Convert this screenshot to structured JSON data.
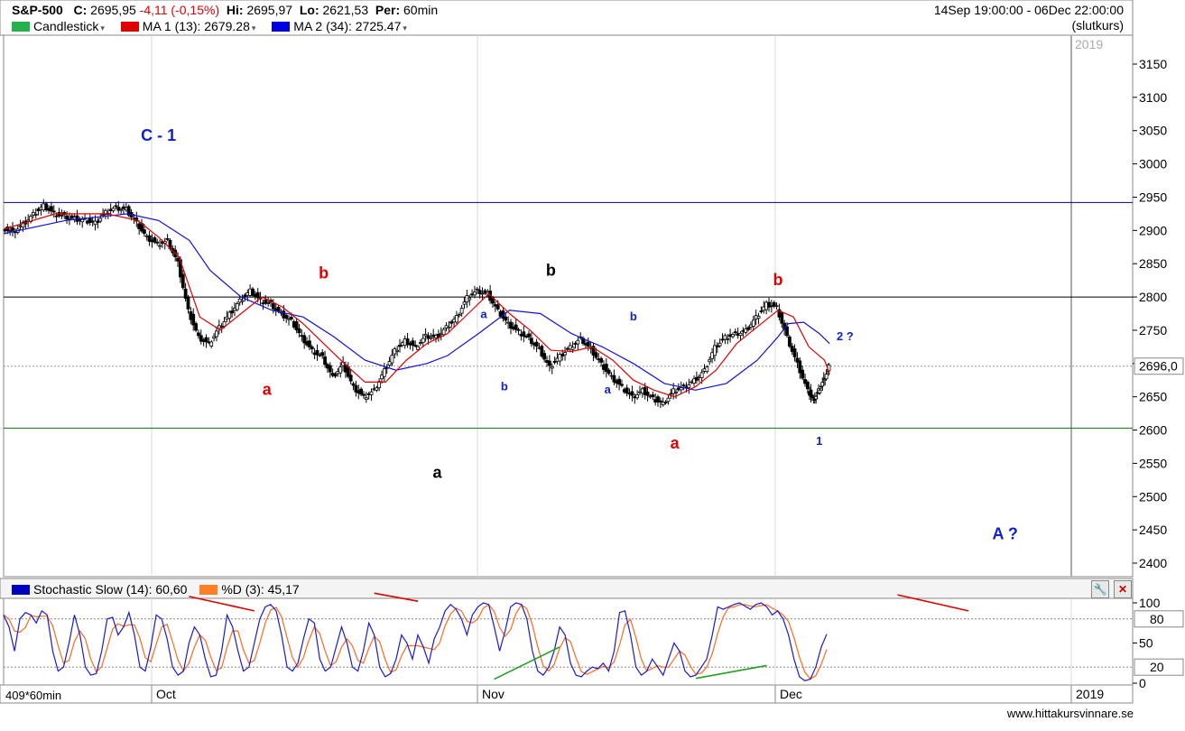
{
  "header": {
    "symbol": "S&P-500",
    "close_label": "C:",
    "close_value": "2695,95",
    "change": "-4,11 (-0,15%)",
    "hi_label": "Hi:",
    "hi_value": "2695,97",
    "lo_label": "Lo:",
    "lo_value": "2621,53",
    "per_label": "Per:",
    "per_value": "60min",
    "date_range": "14Sep 19:00:00 - 06Dec 22:00:00",
    "price_type": "(slutkurs)"
  },
  "legend": [
    {
      "label": "Candlestick",
      "color": "#22b14c"
    },
    {
      "label": "MA 1 (13): 2679.28",
      "color": "#e00000"
    },
    {
      "label": "MA 2 (34): 2725.47",
      "color": "#0000e0"
    }
  ],
  "stoch_legend": [
    {
      "label": "Stochastic Slow (14): 60,60",
      "color": "#0000c0"
    },
    {
      "label": "%D (3): 45,17",
      "color": "#ff7f27"
    }
  ],
  "footer": {
    "bars_label": "409*60min",
    "watermark": "www.hittakursvinnare.se"
  },
  "colors": {
    "ma1": "#e00000",
    "ma2": "#1010e0",
    "candle": "#000000",
    "stoch_k": "#1a1ad0",
    "stoch_d": "#ff6a1a",
    "annot_red": "#e00000",
    "annot_blue": "#1020d0",
    "annot_black": "#000000"
  },
  "chart_data": [
    {
      "type": "candlestick",
      "title": "S&P-500",
      "y_ticks": [
        2400,
        2450,
        2500,
        2550,
        2600,
        2650,
        2700,
        2750,
        2800,
        2850,
        2900,
        2950,
        3000,
        3050,
        3100,
        3150
      ],
      "ylim": [
        2380,
        3180
      ],
      "x_ticks": [
        "Oct",
        "Nov",
        "Dec",
        "2019"
      ],
      "x_top_label": "2019",
      "last_price_label": "2696,0",
      "last_price": 2696,
      "horizontal_lines": [
        {
          "value": 2942,
          "color": "#0000a0"
        },
        {
          "value": 2800,
          "color": "#000000"
        },
        {
          "value": 2603,
          "color": "#008000"
        },
        {
          "value": 2696,
          "color": "#999999",
          "dashed": true
        }
      ],
      "price_path": [
        [
          0,
          2905
        ],
        [
          2,
          2898
        ],
        [
          4,
          2910
        ],
        [
          6,
          2925
        ],
        [
          8,
          2938
        ],
        [
          10,
          2926
        ],
        [
          12,
          2922
        ],
        [
          14,
          2918
        ],
        [
          16,
          2916
        ],
        [
          18,
          2912
        ],
        [
          20,
          2928
        ],
        [
          22,
          2935
        ],
        [
          24,
          2932
        ],
        [
          26,
          2912
        ],
        [
          28,
          2890
        ],
        [
          30,
          2880
        ],
        [
          32,
          2885
        ],
        [
          34,
          2852
        ],
        [
          36,
          2780
        ],
        [
          38,
          2740
        ],
        [
          40,
          2730
        ],
        [
          42,
          2755
        ],
        [
          44,
          2775
        ],
        [
          46,
          2795
        ],
        [
          48,
          2810
        ],
        [
          50,
          2795
        ],
        [
          52,
          2790
        ],
        [
          54,
          2775
        ],
        [
          56,
          2765
        ],
        [
          58,
          2740
        ],
        [
          60,
          2720
        ],
        [
          62,
          2710
        ],
        [
          64,
          2680
        ],
        [
          66,
          2700
        ],
        [
          68,
          2665
        ],
        [
          70,
          2650
        ],
        [
          72,
          2660
        ],
        [
          74,
          2690
        ],
        [
          76,
          2720
        ],
        [
          78,
          2735
        ],
        [
          80,
          2725
        ],
        [
          82,
          2742
        ],
        [
          84,
          2740
        ],
        [
          86,
          2755
        ],
        [
          88,
          2770
        ],
        [
          90,
          2800
        ],
        [
          92,
          2810
        ],
        [
          94,
          2805
        ],
        [
          96,
          2780
        ],
        [
          98,
          2760
        ],
        [
          100,
          2748
        ],
        [
          102,
          2738
        ],
        [
          104,
          2722
        ],
        [
          106,
          2695
        ],
        [
          108,
          2712
        ],
        [
          110,
          2725
        ],
        [
          112,
          2738
        ],
        [
          114,
          2722
        ],
        [
          116,
          2700
        ],
        [
          118,
          2680
        ],
        [
          120,
          2665
        ],
        [
          122,
          2650
        ],
        [
          124,
          2660
        ],
        [
          126,
          2648
        ],
        [
          128,
          2640
        ],
        [
          130,
          2660
        ],
        [
          132,
          2665
        ],
        [
          134,
          2675
        ],
        [
          136,
          2690
        ],
        [
          138,
          2725
        ],
        [
          140,
          2740
        ],
        [
          142,
          2745
        ],
        [
          144,
          2750
        ],
        [
          146,
          2770
        ],
        [
          148,
          2790
        ],
        [
          150,
          2785
        ],
        [
          152,
          2740
        ],
        [
          154,
          2700
        ],
        [
          156,
          2660
        ],
        [
          157,
          2645
        ],
        [
          158,
          2660
        ],
        [
          159,
          2676
        ],
        [
          160,
          2696
        ]
      ],
      "ma1_path": [
        [
          0,
          2902
        ],
        [
          10,
          2925
        ],
        [
          20,
          2925
        ],
        [
          26,
          2915
        ],
        [
          30,
          2890
        ],
        [
          34,
          2860
        ],
        [
          38,
          2770
        ],
        [
          42,
          2750
        ],
        [
          46,
          2775
        ],
        [
          50,
          2800
        ],
        [
          54,
          2785
        ],
        [
          58,
          2760
        ],
        [
          62,
          2730
        ],
        [
          66,
          2700
        ],
        [
          70,
          2672
        ],
        [
          74,
          2672
        ],
        [
          78,
          2705
        ],
        [
          82,
          2730
        ],
        [
          86,
          2745
        ],
        [
          90,
          2775
        ],
        [
          94,
          2805
        ],
        [
          98,
          2775
        ],
        [
          102,
          2750
        ],
        [
          106,
          2720
        ],
        [
          110,
          2718
        ],
        [
          114,
          2725
        ],
        [
          118,
          2705
        ],
        [
          122,
          2675
        ],
        [
          126,
          2660
        ],
        [
          130,
          2650
        ],
        [
          134,
          2665
        ],
        [
          138,
          2690
        ],
        [
          142,
          2730
        ],
        [
          146,
          2755
        ],
        [
          150,
          2780
        ],
        [
          153,
          2770
        ],
        [
          156,
          2725
        ],
        [
          159,
          2705
        ],
        [
          160,
          2685
        ]
      ],
      "ma2_path": [
        [
          0,
          2895
        ],
        [
          12,
          2915
        ],
        [
          24,
          2925
        ],
        [
          30,
          2915
        ],
        [
          36,
          2885
        ],
        [
          40,
          2840
        ],
        [
          46,
          2800
        ],
        [
          52,
          2780
        ],
        [
          58,
          2770
        ],
        [
          64,
          2740
        ],
        [
          70,
          2705
        ],
        [
          76,
          2690
        ],
        [
          82,
          2700
        ],
        [
          86,
          2712
        ],
        [
          92,
          2745
        ],
        [
          98,
          2780
        ],
        [
          104,
          2775
        ],
        [
          110,
          2745
        ],
        [
          116,
          2725
        ],
        [
          122,
          2700
        ],
        [
          128,
          2670
        ],
        [
          134,
          2660
        ],
        [
          140,
          2670
        ],
        [
          146,
          2705
        ],
        [
          150,
          2740
        ],
        [
          152,
          2760
        ],
        [
          155,
          2762
        ],
        [
          158,
          2745
        ],
        [
          160,
          2730
        ]
      ],
      "annotations": [
        {
          "text": "C - 1",
          "x": 30,
          "y": 3035,
          "color": "blue"
        },
        {
          "text": "b",
          "x": 62,
          "y": 2828,
          "color": "red"
        },
        {
          "text": "a",
          "x": 51,
          "y": 2653,
          "color": "red"
        },
        {
          "text": "b",
          "x": 106,
          "y": 2832,
          "color": "black"
        },
        {
          "text": "a",
          "x": 84,
          "y": 2528,
          "color": "black"
        },
        {
          "text": "a",
          "x": 93,
          "y": 2768,
          "color": "blue",
          "small": true
        },
        {
          "text": "b",
          "x": 97,
          "y": 2660,
          "color": "blue",
          "small": true
        },
        {
          "text": "a",
          "x": 117,
          "y": 2655,
          "color": "blue",
          "small": true
        },
        {
          "text": "b",
          "x": 122,
          "y": 2765,
          "color": "blue",
          "small": true
        },
        {
          "text": "b",
          "x": 150,
          "y": 2818,
          "color": "red"
        },
        {
          "text": "a",
          "x": 130,
          "y": 2572,
          "color": "red"
        },
        {
          "text": "2 ?",
          "x": 163,
          "y": 2735,
          "color": "blue",
          "small": true
        },
        {
          "text": "1",
          "x": 158,
          "y": 2578,
          "color": "blue",
          "small": true
        },
        {
          "text": "A ?",
          "x": 194,
          "y": 2436,
          "color": "blue"
        }
      ]
    },
    {
      "type": "line",
      "title": "Stochastic Slow (14)",
      "y_ticks": [
        0,
        50,
        100
      ],
      "ylim": [
        0,
        100
      ],
      "reference_levels": [
        {
          "value": 80,
          "label": "80"
        },
        {
          "value": 20,
          "label": "20"
        }
      ],
      "series": [
        {
          "name": "Stochastic Slow (14)",
          "last": 60.6
        },
        {
          "name": "%D (3)",
          "last": 45.17
        }
      ],
      "k_values": [
        85,
        70,
        40,
        80,
        88,
        85,
        75,
        90,
        85,
        40,
        15,
        20,
        50,
        85,
        60,
        20,
        10,
        12,
        40,
        80,
        82,
        60,
        70,
        88,
        60,
        20,
        15,
        45,
        85,
        80,
        55,
        20,
        10,
        15,
        50,
        70,
        60,
        30,
        8,
        10,
        40,
        85,
        70,
        40,
        15,
        20,
        50,
        80,
        95,
        98,
        90,
        60,
        20,
        15,
        25,
        55,
        80,
        75,
        30,
        15,
        20,
        45,
        70,
        50,
        20,
        15,
        40,
        75,
        60,
        20,
        8,
        12,
        30,
        60,
        50,
        30,
        60,
        45,
        25,
        55,
        70,
        90,
        98,
        92,
        80,
        60,
        85,
        95,
        100,
        98,
        70,
        40,
        65,
        95,
        100,
        98,
        80,
        40,
        15,
        10,
        20,
        40,
        70,
        60,
        25,
        10,
        8,
        15,
        20,
        18,
        25,
        15,
        40,
        88,
        90,
        60,
        20,
        10,
        15,
        30,
        20,
        10,
        30,
        50,
        40,
        15,
        8,
        10,
        20,
        30,
        60,
        95,
        92,
        95,
        98,
        100,
        96,
        92,
        98,
        100,
        95,
        85,
        90,
        80,
        60,
        30,
        8,
        3,
        5,
        20,
        45,
        61
      ],
      "divergences": [
        {
          "x1": 34,
          "y1": 108,
          "x2": 46,
          "y2": 90,
          "color": "red"
        },
        {
          "x1": 68,
          "y1": 112,
          "x2": 76,
          "y2": 102,
          "color": "red"
        },
        {
          "x1": 90,
          "y1": 5,
          "x2": 102,
          "y2": 45,
          "color": "green"
        },
        {
          "x1": 127,
          "y1": 6,
          "x2": 140,
          "y2": 22,
          "color": "green"
        },
        {
          "x1": 164,
          "y1": 110,
          "x2": 177,
          "y2": 90,
          "color": "red"
        }
      ]
    }
  ]
}
